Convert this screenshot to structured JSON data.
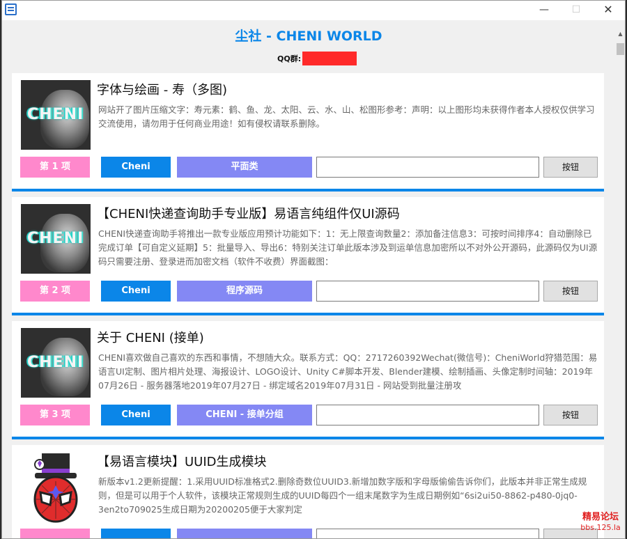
{
  "window": {
    "controls": {
      "minimize": "—",
      "maximize": "☐",
      "close": "✕"
    }
  },
  "header": {
    "title": "尘社 - CHENI WORLD",
    "qq_label": "QQ群:"
  },
  "thumbnail_text": "CHENI",
  "cards": [
    {
      "title": "字体与绘画 - 寿（多图)",
      "description": "网站开了图片压缩文字：寿元素：鹤、鱼、龙、太阳、云、水、山、松图形参考：声明：以上图形均未获得作者本人授权仅供学习交流使用，请勿用于任何商业用途！如有侵权请联系删除。",
      "index_label": "第 1 项",
      "author_label": "Cheni",
      "category_label": "平面类",
      "input_value": "",
      "button_label": "按钮"
    },
    {
      "title": "【CHENI快递查询助手专业版】易语言纯组件仅UI源码",
      "description": "CHENI快递查询助手将推出一款专业版应用预计功能如下：1：无上限查询数量2：添加备注信息3：可按时间排序4：自动删除已完成订单【可自定义延期】5：批量导入、导出6：特别关注订单此版本涉及到运单信息加密所以不对外公开源码，此源码仅为UI源码只需要注册、登录进而加密文档（软件不收费）界面截图：",
      "index_label": "第 2 项",
      "author_label": "Cheni",
      "category_label": "程序源码",
      "input_value": "",
      "button_label": "按钮"
    },
    {
      "title": "关于 CHENI (接单)",
      "description": "CHENI喜欢做自己喜欢的东西和事情，不想随大众。联系方式：QQ：2717260392Wechat(微信号)：CheniWorld狩猎范围：易语言UI定制、图片相片处理、海报设计、LOGO设计、Unity C#脚本开发、Blender建模、绘制插画、头像定制时间轴：2019年07月26日 - 服务器落地2019年07月27日 - 绑定域名2019年07月31日 - 网站受到批量注册攻",
      "index_label": "第 3 项",
      "author_label": "Cheni",
      "category_label": "CHENI - 接单分组",
      "input_value": "",
      "button_label": "按钮"
    },
    {
      "title": "【易语言模块】UUID生成模块",
      "description": "新版本v1.2更新提醒：1.采用UUID标准格式2.删除奇数位UUID3.新增加数字版和字母版偷偷告诉你们，此版本并非正常生成规则，但是可以用于个人软件，该模块正常规则生成的UUID每四个一组末尾数字为生成日期例如“6si2ui50-8862-p480-0jq0-3en2to709025生成日期为20200205便于大家判定",
      "index_label": "",
      "author_label": "",
      "category_label": "",
      "input_value": "",
      "button_label": ""
    }
  ],
  "watermark": {
    "line1": "精易论坛",
    "line2": "bbs.125.la"
  },
  "colors": {
    "accent": "#0b86e8",
    "index_pink": "#ff88cc",
    "category_purple": "#8488f4",
    "redaction": "#ff2a2a",
    "watermark_red": "#e02020"
  },
  "icons": {
    "app": "app-icon",
    "scroll_up": "chevron-up-icon",
    "mascot": "magician-mascot-icon"
  }
}
